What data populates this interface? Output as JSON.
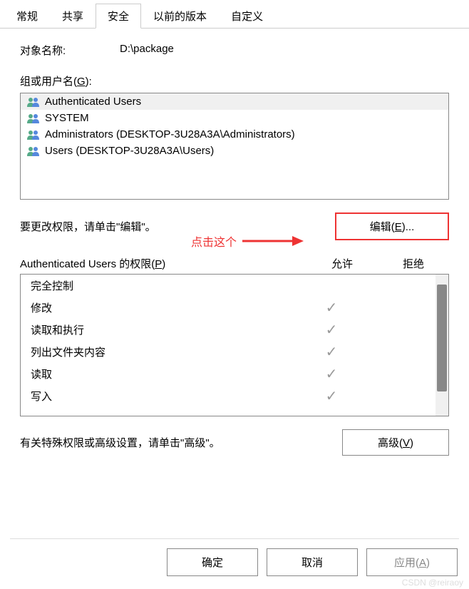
{
  "tabs": [
    {
      "label": "常规",
      "active": false
    },
    {
      "label": "共享",
      "active": false
    },
    {
      "label": "安全",
      "active": true
    },
    {
      "label": "以前的版本",
      "active": false
    },
    {
      "label": "自定义",
      "active": false
    }
  ],
  "object_name_label": "对象名称:",
  "object_name_value": "D:\\package",
  "groups_label_prefix": "组或用户名(",
  "groups_label_hotkey": "G",
  "groups_label_suffix": "):",
  "groups": [
    {
      "name": "Authenticated Users",
      "selected": true
    },
    {
      "name": "SYSTEM",
      "selected": false
    },
    {
      "name": "Administrators (DESKTOP-3U28A3A\\Administrators)",
      "selected": false
    },
    {
      "name": "Users (DESKTOP-3U28A3A\\Users)",
      "selected": false
    }
  ],
  "edit_hint": "要更改权限，请单击\"编辑\"。",
  "edit_button_prefix": "编辑(",
  "edit_button_hotkey": "E",
  "edit_button_suffix": ")...",
  "annotation_text": "点击这个",
  "perm_label_prefix": "Authenticated Users 的权限(",
  "perm_label_hotkey": "P",
  "perm_label_suffix": ")",
  "perm_col_allow": "允许",
  "perm_col_deny": "拒绝",
  "permissions": [
    {
      "name": "完全控制",
      "allow": false,
      "deny": false
    },
    {
      "name": "修改",
      "allow": true,
      "deny": false
    },
    {
      "name": "读取和执行",
      "allow": true,
      "deny": false
    },
    {
      "name": "列出文件夹内容",
      "allow": true,
      "deny": false
    },
    {
      "name": "读取",
      "allow": true,
      "deny": false
    },
    {
      "name": "写入",
      "allow": true,
      "deny": false
    }
  ],
  "advanced_hint": "有关特殊权限或高级设置，请单击\"高级\"。",
  "advanced_button_prefix": "高级(",
  "advanced_button_hotkey": "V",
  "advanced_button_suffix": ")",
  "footer": {
    "ok": "确定",
    "cancel": "取消",
    "apply_prefix": "应用(",
    "apply_hotkey": "A",
    "apply_suffix": ")"
  },
  "watermark": "CSDN @reiraoy"
}
